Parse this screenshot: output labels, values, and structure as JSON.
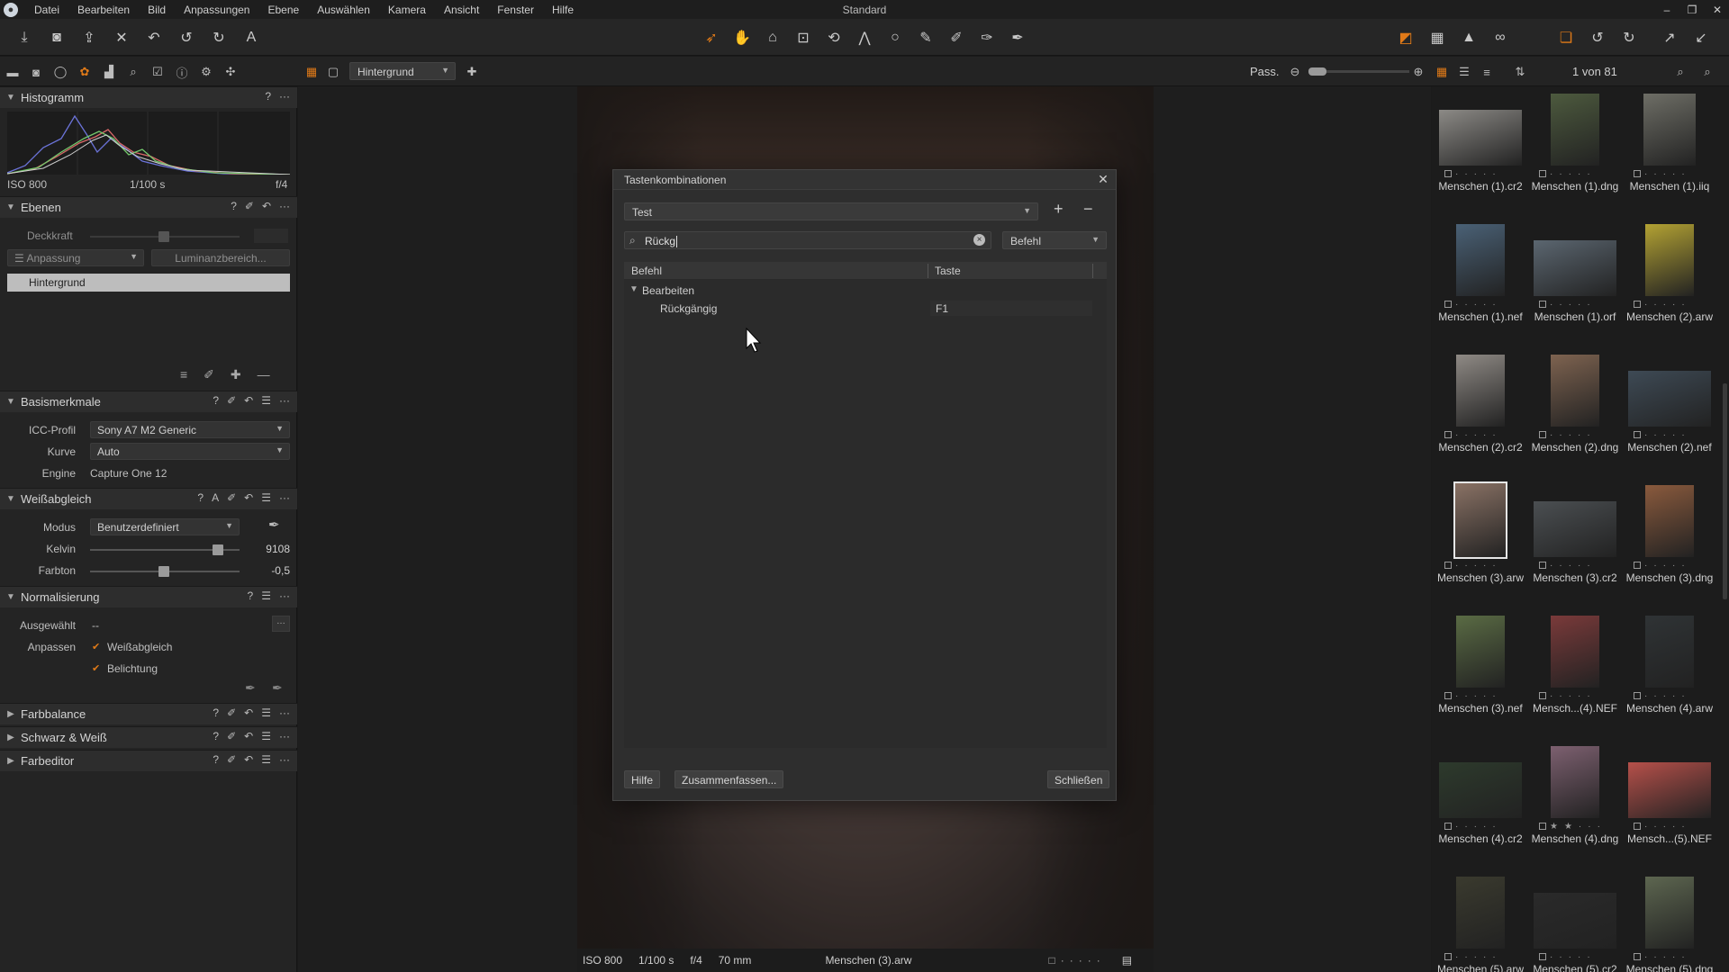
{
  "app": {
    "menu": [
      "Datei",
      "Bearbeiten",
      "Bild",
      "Anpassungen",
      "Ebene",
      "Auswählen",
      "Kamera",
      "Ansicht",
      "Fenster",
      "Hilfe"
    ],
    "title": "Standard"
  },
  "viewer": {
    "layer_select": "Hintergrund",
    "zoom_label": "Pass.",
    "counter": "1 von 81",
    "status": {
      "iso": "ISO 800",
      "shutter": "1/100 s",
      "aperture": "f/4",
      "focal": "70 mm",
      "filename": "Menschen (3).arw"
    }
  },
  "left": {
    "histogram": {
      "title": "Histogramm",
      "iso": "ISO 800",
      "shutter": "1/100 s",
      "aperture": "f/4"
    },
    "layers": {
      "title": "Ebenen",
      "opacity_label": "Deckkraft",
      "adjust_btn": "Anpassung",
      "luma_btn": "Luminanzbereich...",
      "layer": "Hintergrund"
    },
    "basic": {
      "title": "Basismerkmale",
      "icc_label": "ICC-Profil",
      "icc_value": "Sony A7 M2 Generic",
      "curve_label": "Kurve",
      "curve_value": "Auto",
      "engine_label": "Engine",
      "engine_value": "Capture One 12"
    },
    "wb": {
      "title": "Weißabgleich",
      "mode_label": "Modus",
      "mode_value": "Benutzerdefiniert",
      "kelvin_label": "Kelvin",
      "kelvin_value": "9108",
      "tint_label": "Farbton",
      "tint_value": "-0,5"
    },
    "norm": {
      "title": "Normalisierung",
      "selected_label": "Ausgewählt",
      "selected_value": "--",
      "adjust_label": "Anpassen",
      "opt1": "Weißabgleich",
      "opt2": "Belichtung"
    },
    "collapsed": [
      "Farbbalance",
      "Schwarz & Weiß",
      "Farbeditor"
    ]
  },
  "dialog": {
    "title": "Tastenkombinationen",
    "set": "Test",
    "search_value": "Rückg",
    "filter": "Befehl",
    "col_command": "Befehl",
    "col_key": "Taste",
    "group": "Bearbeiten",
    "item": "Rückgängig",
    "item_key": "F1",
    "btn_help": "Hilfe",
    "btn_summary": "Zusammenfassen...",
    "btn_close": "Schließen"
  },
  "thumbnails": [
    {
      "name": "Menschen (1).cr2",
      "color": "#8c8a86",
      "w": 92,
      "h": 62
    },
    {
      "name": "Menschen (1).dng",
      "color": "#4d5a3e",
      "w": 54,
      "h": 80
    },
    {
      "name": "Menschen (1).iiq",
      "color": "#6e6e66",
      "w": 58,
      "h": 80
    },
    {
      "name": "Menschen (1).nef",
      "color": "#4a6176",
      "w": 54,
      "h": 80
    },
    {
      "name": "Menschen (1).orf",
      "color": "#5b6670",
      "w": 92,
      "h": 62
    },
    {
      "name": "Menschen (2).arw",
      "color": "#b3a233",
      "w": 54,
      "h": 80
    },
    {
      "name": "Menschen (2).cr2",
      "color": "#8f8a85",
      "w": 54,
      "h": 80
    },
    {
      "name": "Menschen (2).dng",
      "color": "#7e6350",
      "w": 54,
      "h": 80
    },
    {
      "name": "Menschen (2).nef",
      "color": "#3e4a55",
      "w": 92,
      "h": 62
    },
    {
      "name": "Menschen (3).arw",
      "color": "#8a7265",
      "w": 56,
      "h": 82
    },
    {
      "name": "Menschen (3).cr2",
      "color": "#4b4f52",
      "w": 92,
      "h": 62
    },
    {
      "name": "Menschen (3).dng",
      "color": "#8a5a3d",
      "w": 54,
      "h": 80
    },
    {
      "name": "Menschen (3).nef",
      "color": "#5a6b44",
      "w": 54,
      "h": 80
    },
    {
      "name": "Mensch...(4).NEF",
      "color": "#7a3a3a",
      "w": 54,
      "h": 80
    },
    {
      "name": "Menschen (4).arw",
      "color": "#2f3335",
      "w": 54,
      "h": 80
    },
    {
      "name": "Menschen (4).cr2",
      "color": "#2d3a2c",
      "w": 92,
      "h": 62
    },
    {
      "name": "Menschen (4).dng",
      "color": "#7d6070",
      "w": 54,
      "h": 80
    },
    {
      "name": "Mensch...(5).NEF",
      "color": "#b6504a",
      "w": 92,
      "h": 62
    },
    {
      "name": "Menschen (5).arw",
      "color": "#3a3a2e",
      "w": 54,
      "h": 80
    },
    {
      "name": "Menschen (5).cr2",
      "color": "#2a2a2a",
      "w": 92,
      "h": 62
    },
    {
      "name": "Menschen (5).dng",
      "color": "#5d6650",
      "w": 54,
      "h": 80
    }
  ]
}
